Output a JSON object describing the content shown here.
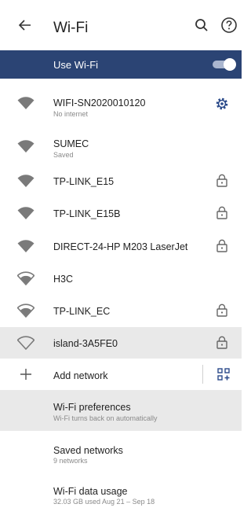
{
  "header": {
    "title": "Wi-Fi"
  },
  "use_wifi": {
    "label": "Use Wi-Fi",
    "enabled": true
  },
  "networks": [
    {
      "name": "WIFI-SN2020010120",
      "status": "No internet"
    },
    {
      "name": "SUMEC",
      "status": "Saved"
    },
    {
      "name": "TP-LINK_E15"
    },
    {
      "name": "TP-LINK_E15B"
    },
    {
      "name": "DIRECT-24-HP M203 LaserJet"
    },
    {
      "name": "H3C"
    },
    {
      "name": "TP-LINK_EC"
    },
    {
      "name": "island-3A5FE0"
    }
  ],
  "add_network": {
    "label": "Add network"
  },
  "preferences": {
    "title": "Wi-Fi preferences",
    "subtitle": "Wi-Fi turns back on automatically"
  },
  "saved": {
    "title": "Saved networks",
    "subtitle": "9 networks"
  },
  "usage": {
    "title": "Wi-Fi data usage",
    "subtitle": "32.03 GB used Aug 21 – Sep 18"
  },
  "colors": {
    "accent_bar": "#2b4474",
    "icon_blue": "#2b4a8a",
    "selected_row": "#e9e9e9"
  }
}
